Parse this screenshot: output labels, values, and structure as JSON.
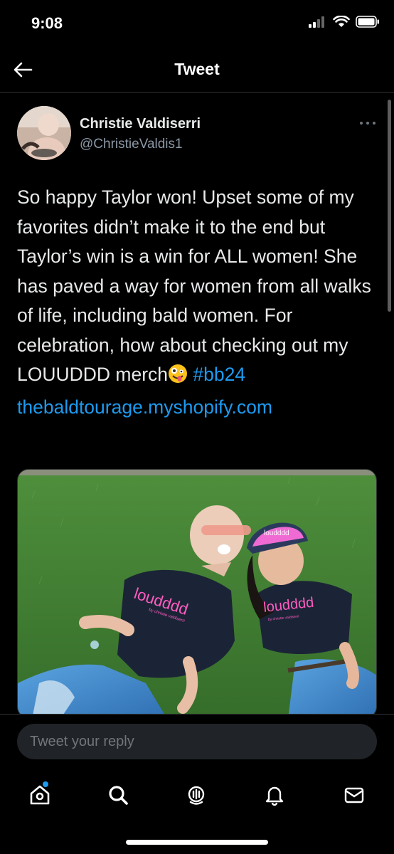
{
  "status_bar": {
    "time": "9:08"
  },
  "header": {
    "title": "Tweet"
  },
  "tweet": {
    "display_name": "Christie Valdiserri",
    "handle": "@ChristieValdis1",
    "text_main": "So happy Taylor won! Upset some of my favorites didn’t make it to the end but Taylor’s win is a win for ALL women! She has paved a way for women from all walks of life, including bald women. For celebration, how about checking out my LOUUDDD merch",
    "hashtag": "#bb24",
    "link": "thebaldtourage.myshopify.com",
    "media": {
      "shirt_text_left": "loudddd",
      "shirt_subtext_left": "by christie valdiserri",
      "shirt_text_right": "loudddd",
      "shirt_subtext_right": "by christie valdiserri",
      "cap_text": "loudddd"
    }
  },
  "reply": {
    "placeholder": "Tweet your reply"
  },
  "colors": {
    "accent": "#1d9bf0",
    "background": "#000000",
    "text": "#e7e9ea",
    "secondary": "#8b98a5"
  },
  "tabs": [
    "home-icon",
    "search-icon",
    "spaces-icon",
    "notifications-icon",
    "messages-icon"
  ]
}
